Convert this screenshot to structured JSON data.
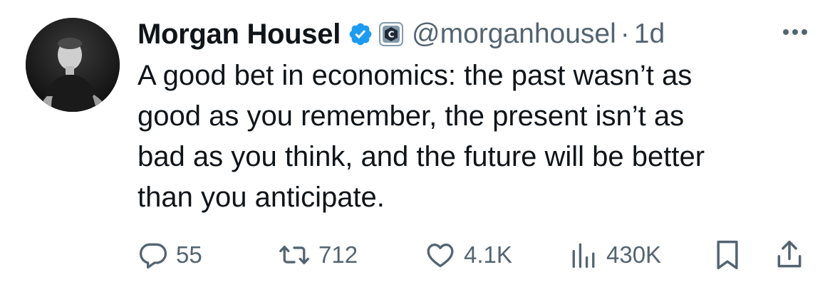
{
  "author": {
    "display_name": "Morgan Housel",
    "handle": "@morganhousel",
    "separator": "·",
    "time": "1d"
  },
  "tweet": {
    "lines": [
      "A good bet in economics: the past wasn’t as",
      "good as you remember, the present isn’t as",
      "bad as you think, and the future will be better",
      "than you anticipate."
    ]
  },
  "actions": {
    "replies": "55",
    "reposts": "712",
    "likes": "4.1K",
    "views": "430K"
  },
  "icons": {
    "verified": "verified-badge-icon",
    "affiliate": "affiliate-badge-icon",
    "more": "more-icon",
    "reply": "reply-icon",
    "repost": "repost-icon",
    "like": "heart-icon",
    "views": "views-icon",
    "bookmark": "bookmark-icon",
    "share": "share-icon"
  },
  "colors": {
    "text": "#0f1419",
    "secondary": "#536471",
    "verified_blue": "#1d9bf0",
    "affiliate_gray": "#829aab"
  }
}
